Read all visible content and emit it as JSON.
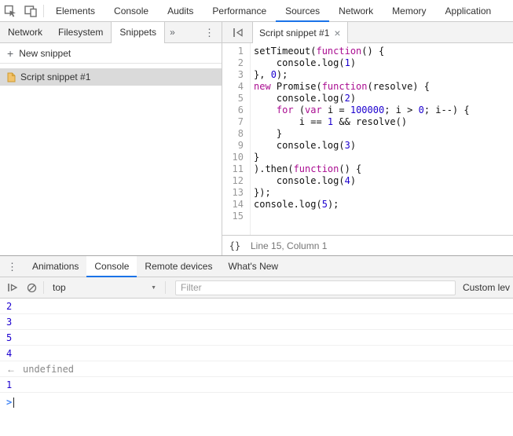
{
  "colors": {
    "accent": "#1a73e8",
    "keyword": "#aa0d91",
    "number": "#1c00cf",
    "result_grey": "#888888",
    "prompt_blue": "#4285f4",
    "selected_bg": "#dadada",
    "toolbar_bg": "#f3f3f3",
    "border": "#cccccc"
  },
  "main_tabbar": {
    "active": "Sources",
    "tabs": [
      "Elements",
      "Console",
      "Audits",
      "Performance",
      "Sources",
      "Network",
      "Memory",
      "Application"
    ]
  },
  "sources_subtabs": {
    "active": "Snippets",
    "tabs": [
      "Network",
      "Filesystem",
      "Snippets"
    ],
    "more_tabs_glyph": "»",
    "more_options_glyph": "⋮"
  },
  "navigator": {
    "plus_glyph": "+",
    "new_snippet_label": "New snippet",
    "snippet_name": "Script snippet #1"
  },
  "editor": {
    "tab_title": "Script snippet #1",
    "close_glyph": "×",
    "pretty_print_glyph": "{}",
    "status": "Line 15, Column 1",
    "lines": [
      [
        [
          "setTimeout(",
          "p"
        ],
        [
          "function",
          "k"
        ],
        [
          "() {",
          "p"
        ]
      ],
      [
        [
          "    console.log(",
          "p"
        ],
        [
          "1",
          "n"
        ],
        [
          ")",
          "p"
        ]
      ],
      [
        [
          "}, ",
          "p"
        ],
        [
          "0",
          "n"
        ],
        [
          ");",
          "p"
        ]
      ],
      [
        [
          "new ",
          "k"
        ],
        [
          "Promise(",
          "p"
        ],
        [
          "function",
          "k"
        ],
        [
          "(resolve) {",
          "p"
        ]
      ],
      [
        [
          "    console.log(",
          "p"
        ],
        [
          "2",
          "n"
        ],
        [
          ")",
          "p"
        ]
      ],
      [
        [
          "    ",
          "p"
        ],
        [
          "for",
          "k"
        ],
        [
          " (",
          "p"
        ],
        [
          "var",
          "k"
        ],
        [
          " i = ",
          "p"
        ],
        [
          "100000",
          "n"
        ],
        [
          "; i > ",
          "p"
        ],
        [
          "0",
          "n"
        ],
        [
          "; i--) {",
          "p"
        ]
      ],
      [
        [
          "        i == ",
          "p"
        ],
        [
          "1",
          "n"
        ],
        [
          " && resolve()",
          "p"
        ]
      ],
      [
        [
          "    }",
          "p"
        ]
      ],
      [
        [
          "    console.log(",
          "p"
        ],
        [
          "3",
          "n"
        ],
        [
          ")",
          "p"
        ]
      ],
      [
        [
          "}",
          "p"
        ]
      ],
      [
        [
          ").then(",
          "p"
        ],
        [
          "function",
          "k"
        ],
        [
          "() {",
          "p"
        ]
      ],
      [
        [
          "    console.log(",
          "p"
        ],
        [
          "4",
          "n"
        ],
        [
          ")",
          "p"
        ]
      ],
      [
        [
          "});",
          "p"
        ]
      ],
      [
        [
          "console.log(",
          "p"
        ],
        [
          "5",
          "n"
        ],
        [
          ");",
          "p"
        ]
      ],
      []
    ]
  },
  "drawer_tabbar": {
    "active": "Console",
    "tabs": [
      "Animations",
      "Console",
      "Remote devices",
      "What's New"
    ],
    "more_options_glyph": "⋮"
  },
  "console": {
    "context_selector": "top",
    "context_dropdown_glyph": "▼",
    "filter_placeholder": "Filter",
    "custom_levels_label": "Custom lev",
    "messages": [
      {
        "kind": "log",
        "text": "2"
      },
      {
        "kind": "log",
        "text": "3"
      },
      {
        "kind": "log",
        "text": "5"
      },
      {
        "kind": "log",
        "text": "4"
      },
      {
        "kind": "result",
        "text": "undefined",
        "arrow": "←"
      },
      {
        "kind": "log",
        "text": "1"
      },
      {
        "kind": "prompt",
        "text": ">"
      }
    ]
  }
}
